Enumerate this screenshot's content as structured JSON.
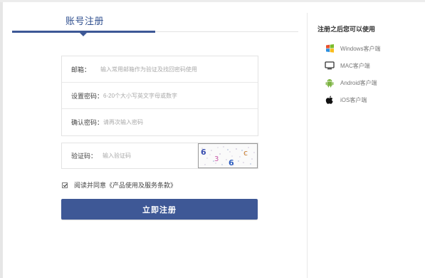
{
  "tab": {
    "title": "账号注册"
  },
  "form": {
    "email_label": "邮箱：",
    "email_placeholder": "输入常用邮箱作为验证及找回密码使用",
    "password_label": "设置密码：",
    "password_placeholder": "6-20个大小写英文字母或数字",
    "confirm_label": "确认密码：",
    "confirm_placeholder": "请再次输入密码",
    "captcha_label": "验证码：",
    "captcha_placeholder": "输入验证码",
    "captcha_chars": [
      "6",
      "3",
      "6",
      "c"
    ],
    "agree_text": "阅读并同意《产品使用及服务条款》",
    "agree_checked": true,
    "submit_label": "立即注册"
  },
  "sidebar": {
    "title": "注册之后您可以使用",
    "clients": [
      {
        "label": "Windows客户端",
        "icon": "windows-icon"
      },
      {
        "label": "MAC客户端",
        "icon": "mac-monitor-icon"
      },
      {
        "label": "Android客户端",
        "icon": "android-icon"
      },
      {
        "label": "iOS客户端",
        "icon": "apple-icon"
      }
    ]
  },
  "colors": {
    "accent": "#3e5896",
    "tab_text": "#2f4f8f"
  }
}
